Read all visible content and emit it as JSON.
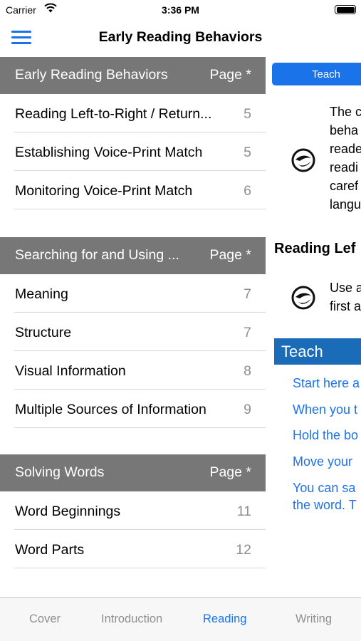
{
  "status_bar": {
    "carrier": "Carrier",
    "time": "3:36 PM"
  },
  "nav": {
    "title": "Early Reading Behaviors"
  },
  "toc": {
    "sections": [
      {
        "title": "Early Reading Behaviors",
        "page_header": "Page *",
        "rows": [
          {
            "label": "Reading Left-to-Right / Return...",
            "page": "5"
          },
          {
            "label": "Establishing Voice-Print Match",
            "page": "5"
          },
          {
            "label": "Monitoring Voice-Print Match",
            "page": "6"
          }
        ]
      },
      {
        "title": "Searching for and Using ...",
        "page_header": "Page *",
        "rows": [
          {
            "label": "Meaning",
            "page": "7"
          },
          {
            "label": "Structure",
            "page": "7"
          },
          {
            "label": "Visual Information",
            "page": "8"
          },
          {
            "label": "Multiple Sources of Information",
            "page": "9"
          }
        ]
      },
      {
        "title": "Solving Words",
        "page_header": "Page *",
        "rows": [
          {
            "label": "Word Beginnings",
            "page": "11"
          },
          {
            "label": "Word Parts",
            "page": "12"
          }
        ]
      }
    ]
  },
  "detail": {
    "segment_label": "Teach",
    "intro_lines": [
      "The c",
      "beha",
      "reade",
      "readi",
      "caref",
      "langu"
    ],
    "heading": "Reading Lef",
    "use_lines": [
      "Use a",
      "first a"
    ],
    "teach_bar": "Teach",
    "teach_items": [
      "Start here a",
      "When you t",
      "Hold the bo",
      "Move your",
      "You can sa",
      "the word. T"
    ]
  },
  "tabs": [
    {
      "label": "Cover",
      "active": false
    },
    {
      "label": "Introduction",
      "active": false
    },
    {
      "label": "Reading",
      "active": true
    },
    {
      "label": "Writing",
      "active": false
    }
  ],
  "colors": {
    "accent": "#1a73e8",
    "section_header_bg": "#777777",
    "teach_bar_bg": "#1a6bb8"
  }
}
